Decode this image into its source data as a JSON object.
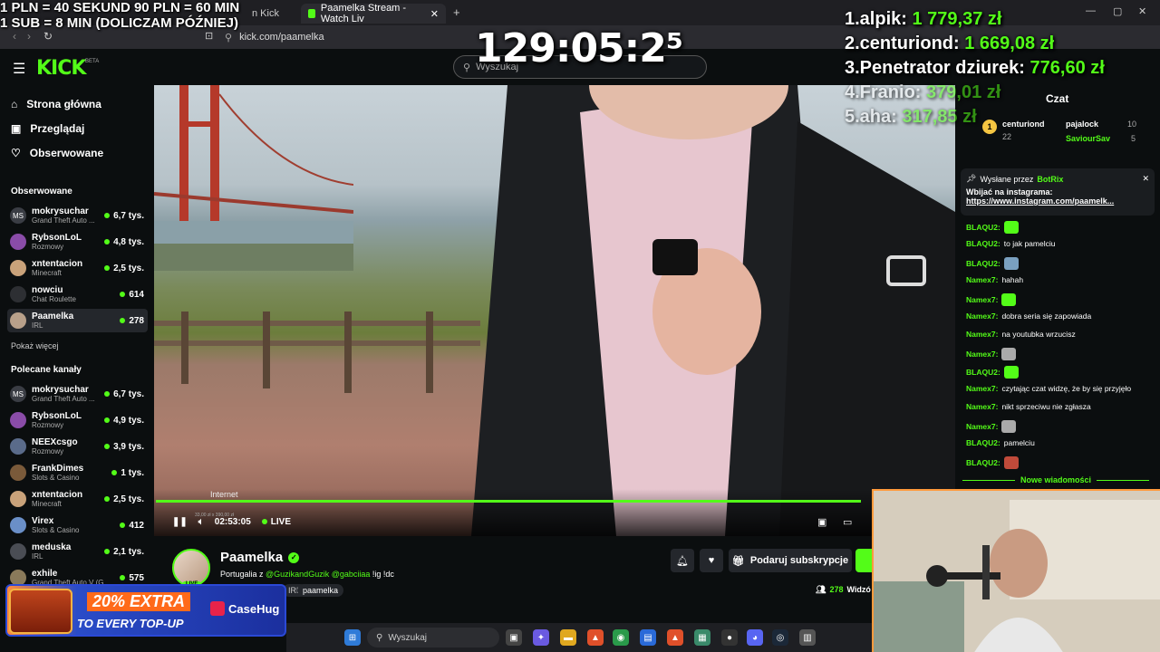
{
  "browser": {
    "tabs": [
      {
        "label": "Paamelka Stream - Watch Liv"
      },
      {
        "label": "n Kick"
      }
    ],
    "url": "kick.com/paamelka"
  },
  "header": {
    "logo": "KICK",
    "logo_badge": "BETA",
    "search_placeholder": "Wyszukaj"
  },
  "sidebar": {
    "nav": [
      {
        "label": "Strona główna",
        "icon": "home-icon"
      },
      {
        "label": "Przeglądaj",
        "icon": "browse-icon"
      },
      {
        "label": "Obserwowane",
        "icon": "heart-icon"
      }
    ],
    "followed_title": "Obserwowane",
    "followed": [
      {
        "name": "mokrysuchar",
        "category": "Grand Theft Auto ...",
        "viewers": "6,7 tys."
      },
      {
        "name": "RybsonLoL",
        "category": "Rozmowy",
        "viewers": "4,8 tys."
      },
      {
        "name": "xntentacion",
        "category": "Minecraft",
        "viewers": "2,5 tys."
      },
      {
        "name": "nowciu",
        "category": "Chat Roulette",
        "viewers": "614"
      },
      {
        "name": "Paamelka",
        "category": "IRL",
        "viewers": "278"
      }
    ],
    "show_more": "Pokaż więcej",
    "recommended_title": "Polecane kanały",
    "recommended": [
      {
        "name": "mokrysuchar",
        "category": "Grand Theft Auto ...",
        "viewers": "6,7 tys."
      },
      {
        "name": "RybsonLoL",
        "category": "Rozmowy",
        "viewers": "4,9 tys."
      },
      {
        "name": "NEEXcsgo",
        "category": "Rozmowy",
        "viewers": "3,9 tys."
      },
      {
        "name": "FrankDimes",
        "category": "Slots & Casino",
        "viewers": "1 tys."
      },
      {
        "name": "xntentacion",
        "category": "Minecraft",
        "viewers": "2,5 tys."
      },
      {
        "name": "Virex",
        "category": "Slots & Casino",
        "viewers": "412"
      },
      {
        "name": "meduska",
        "category": "IRL",
        "viewers": "2,1 tys."
      },
      {
        "name": "exhile",
        "category": "Grand Theft Auto V (G...",
        "viewers": "575"
      }
    ]
  },
  "player": {
    "overlay_label": "Internet",
    "overlay_small": "33,00 zł x 390,00 zł",
    "time": "02:53:05",
    "live_label": "LIVE",
    "progress": 0.88
  },
  "stream": {
    "streamer": "Paamelka",
    "live_badge": "LIVE",
    "title_prefix": "Portugalia z ",
    "mention1": "@GuzikandGuzik",
    "mention2": "@gabciiaa",
    "title_suffix": " !ig !dc",
    "tag_irl": "IRL",
    "tag": "paamelka",
    "subscribe_label": "Podaruj subskrypcje",
    "viewers": "278",
    "viewers_suffix": "Widzó"
  },
  "chat": {
    "title": "Czat",
    "leaders": [
      {
        "name": "centuriond",
        "count": "22"
      },
      {
        "name": "pajalock",
        "count": "10"
      },
      {
        "name": "SaviourSav",
        "count": "5"
      }
    ],
    "pinned_by_label": "Wysłane przez",
    "pinned_by": "BotRix",
    "pinned_text": "Wbijać na instagrama:",
    "pinned_link": "https://www.instagram.com/paamelk...",
    "messages": [
      {
        "nick": "BLAQU2:",
        "text": "",
        "emote": true
      },
      {
        "nick": "BLAQU2:",
        "text": "to jak pamelciu",
        "emote": false
      },
      {
        "nick": "BLAQU2:",
        "text": "",
        "emote": true
      },
      {
        "nick": "Namex7:",
        "text": "hahah",
        "emote": false
      },
      {
        "nick": "Namex7:",
        "text": "",
        "emote": true
      },
      {
        "nick": "Namex7:",
        "text": "dobra seria się zapowiada",
        "emote": false
      },
      {
        "nick": "Namex7:",
        "text": "na youtubka wrzucisz",
        "emote": false
      },
      {
        "nick": "Namex7:",
        "text": "",
        "emote": true
      },
      {
        "nick": "BLAQU2:",
        "text": "",
        "emote": true
      },
      {
        "nick": "Namex7:",
        "text": "czytając czat widzę, że by się przyjęło",
        "emote": false
      },
      {
        "nick": "Namex7:",
        "text": "nikt sprzeciwu nie zgłasza",
        "emote": false
      },
      {
        "nick": "Namex7:",
        "text": "",
        "emote": true
      },
      {
        "nick": "BLAQU2:",
        "text": "pamelciu",
        "emote": false
      },
      {
        "nick": "BLAQU2:",
        "text": "",
        "emote": true
      }
    ],
    "new_messages": "Nowe wiadomości"
  },
  "overlay": {
    "rate_line1": "1 PLN = 40 SEKUND 90 PLN = 60 MIN",
    "rate_line2": "1 SUB = 8 MIN (DOLICZAM PÓŹNIEJ)",
    "timer": "129:05:2⁵",
    "leaderboard": [
      {
        "label": "1.alpik:",
        "amount": "1 779,37 zł"
      },
      {
        "label": "2.centuriond:",
        "amount": "1 669,08 zł"
      },
      {
        "label": "3.Penetrator dziurek:",
        "amount": "776,60 zł"
      },
      {
        "label": "4.Franio:",
        "amount": "379,01 zł"
      },
      {
        "label": "5.aha:",
        "amount": "317,85 zł"
      }
    ]
  },
  "ad": {
    "line1": "20% EXTRA",
    "line2": "TO EVERY TOP-UP",
    "brand": "CaseHug"
  },
  "taskbar": {
    "search_placeholder": "Wyszukaj"
  },
  "colors": {
    "accent": "#53fc18",
    "background": "#0b0e0f"
  }
}
